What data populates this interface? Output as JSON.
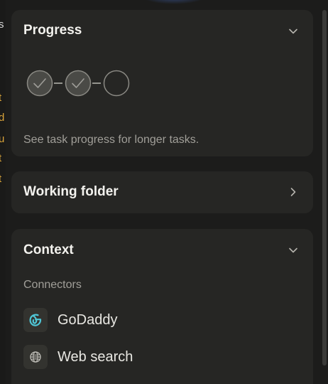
{
  "progress": {
    "title": "Progress",
    "steps": [
      {
        "state": "done"
      },
      {
        "state": "done"
      },
      {
        "state": "pending"
      }
    ],
    "hint": "See task progress for longer tasks."
  },
  "working_folder": {
    "title": "Working folder"
  },
  "context": {
    "title": "Context",
    "section_label": "Connectors",
    "connectors": [
      {
        "label": "GoDaddy",
        "icon": "godaddy-icon"
      },
      {
        "label": "Web search",
        "icon": "globe-icon"
      }
    ]
  },
  "background_fragments": [
    "s",
    "t",
    "d",
    "u",
    "t",
    "t"
  ],
  "colors": {
    "panel": "#262624",
    "background": "#1c1c1b",
    "godaddy_accent": "#4fc6d6",
    "muted_text": "#a19f99"
  }
}
